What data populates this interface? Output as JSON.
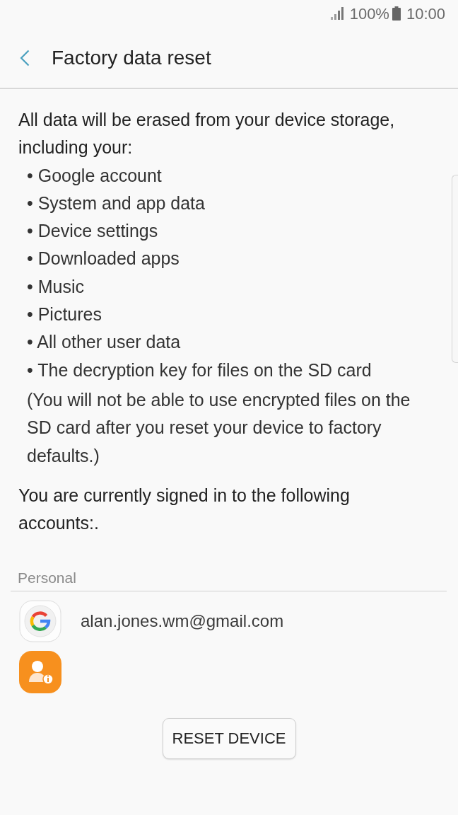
{
  "status_bar": {
    "battery": "100%",
    "time": "10:00"
  },
  "header": {
    "title": "Factory data reset"
  },
  "intro": "All data will be erased from your device storage, including your:",
  "items": [
    "• Google account",
    "• System and app data",
    "• Device settings",
    "• Downloaded apps",
    "• Music",
    "• Pictures",
    "• All other user data",
    "• The decryption key for files on the SD card"
  ],
  "note": "(You will not be able to use encrypted files on the SD card after you reset your device to factory defaults.)",
  "accounts_intro": "You are currently signed in to the following accounts:.",
  "accounts": {
    "section": "Personal",
    "items": [
      {
        "kind": "google",
        "email": "alan.jones.wm@gmail.com"
      },
      {
        "kind": "profile"
      }
    ]
  },
  "button": "RESET DEVICE"
}
